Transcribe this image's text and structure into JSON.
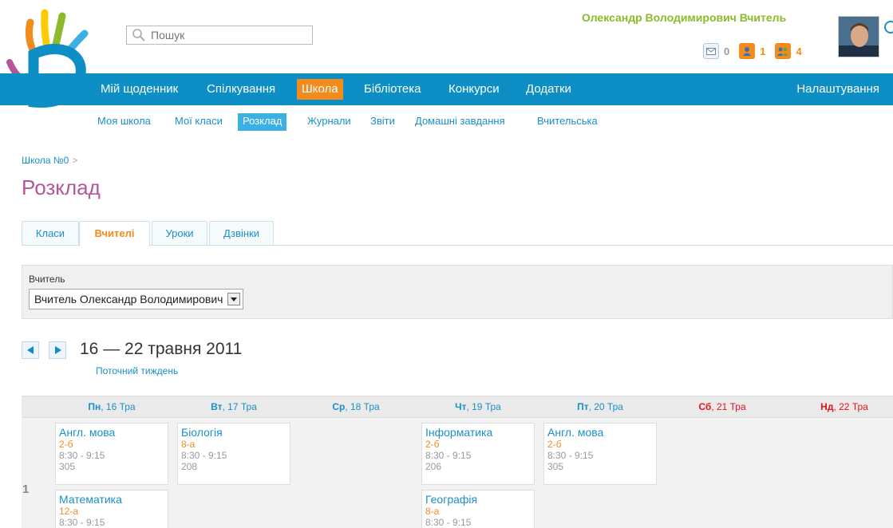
{
  "search": {
    "placeholder": "Пошук"
  },
  "user": {
    "name": "Олександр Володимирович Вчитель",
    "counters": [
      {
        "icon": "mail-icon",
        "value": "0"
      },
      {
        "icon": "person-icon",
        "value": "1"
      },
      {
        "icon": "people-icon",
        "value": "4"
      }
    ]
  },
  "main_nav": {
    "items": [
      "Мій щоденник",
      "Спілкування",
      "Школа",
      "Бібліотека",
      "Конкурси",
      "Додатки"
    ],
    "active": "Школа",
    "settings": "Налаштування"
  },
  "sub_nav": {
    "items": [
      "Моя школа",
      "Мої класи",
      "Розклад",
      "Журнали",
      "Звіти",
      "Домашні завдання",
      "Вчительська"
    ],
    "active": "Розклад"
  },
  "breadcrumb": {
    "school": "Школа №0",
    "sep": ">"
  },
  "page_title": "Розклад",
  "tabs": [
    "Класи",
    "Вчителі",
    "Уроки",
    "Дзвінки"
  ],
  "active_tab": "Вчителі",
  "filter": {
    "label": "Вчитель",
    "selected": "Вчитель Олександр Володимирович"
  },
  "week": {
    "title": "16 — 22 травня 2011",
    "current_link": "Поточний тиждень"
  },
  "days": [
    {
      "abbr": "Пн",
      "date": ", 16 Тра",
      "weekend": false
    },
    {
      "abbr": "Вт",
      "date": ", 17 Тра",
      "weekend": false
    },
    {
      "abbr": "Ср",
      "date": ", 18 Тра",
      "weekend": false
    },
    {
      "abbr": "Чт",
      "date": ", 19 Тра",
      "weekend": false
    },
    {
      "abbr": "Пт",
      "date": ", 20 Тра",
      "weekend": false
    },
    {
      "abbr": "Сб",
      "date": ", 21 Тра",
      "weekend": true
    },
    {
      "abbr": "Нд",
      "date": ", 22 Тра",
      "weekend": true
    }
  ],
  "schedule": {
    "lesson_number": "1",
    "lessons": [
      {
        "subject": "Англ. мова",
        "class": "2-б",
        "time": "8:30 - 9:15",
        "room": "305"
      },
      {
        "subject": "Біологія",
        "class": "8-а",
        "time": "8:30 - 9:15",
        "room": "208"
      },
      {
        "subject": "Інформатика",
        "class": "2-б",
        "time": "8:30 - 9:15",
        "room": "206"
      },
      {
        "subject": "Англ. мова",
        "class": "2-б",
        "time": "8:30 - 9:15",
        "room": "305"
      },
      {
        "subject": "Математика",
        "class": "12-а",
        "time": "8:30 - 9:15",
        "room": ""
      },
      {
        "subject": "Географія",
        "class": "8-а",
        "time": "8:30 - 9:15",
        "room": ""
      }
    ]
  },
  "colors": {
    "nav_blue": "#0d8fc6",
    "accent_orange": "#f48b1d",
    "user_green": "#8bbb2a",
    "title_purple": "#b5569a",
    "weekend_red": "#e8101e"
  }
}
